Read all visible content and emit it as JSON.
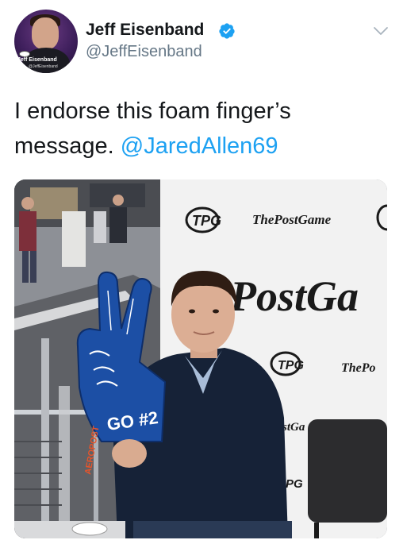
{
  "author": {
    "name": "Jeff Eisenband",
    "handle": "@JeffEisenband",
    "verified": true,
    "avatar_text": "Jeff Eisenband",
    "avatar_handle": "@JeffEisenband"
  },
  "tweet": {
    "text_before": "I endorse this foam finger’s message.",
    "mention": "@JaredAllen69"
  },
  "media": {
    "sign_brand": "TPG",
    "sign_name": "ThePostGame",
    "backdrop_big": "PostGa",
    "backdrop_repeat_1": "ThePo",
    "backdrop_repeat_2": "stGa",
    "backdrop_repeat_3": "PG",
    "foam_finger_text": "GO #2",
    "foam_finger_side": "AEROPOST",
    "colors": {
      "sweater": "#162237",
      "foam_finger": "#1c4fa5",
      "backdrop": "#f2f2f2"
    }
  },
  "icons": {
    "verified": "verified-badge-icon",
    "caret": "chevron-down-icon"
  },
  "colors": {
    "link": "#1da1f2",
    "secondary_text": "#657786",
    "primary_text": "#14171a",
    "verified": "#1da1f2"
  }
}
